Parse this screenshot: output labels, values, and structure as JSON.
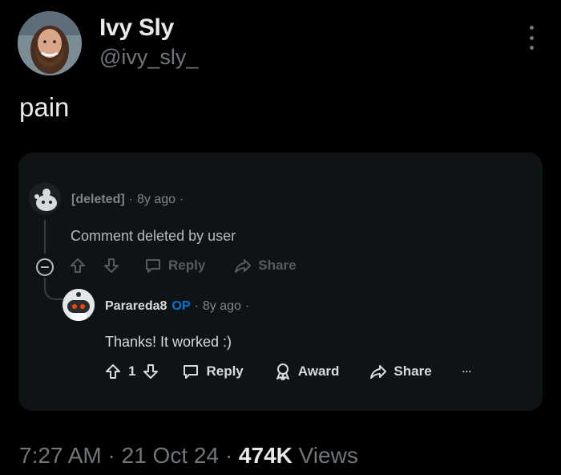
{
  "post": {
    "display_name": "Ivy Sly",
    "handle": "@ivy_sly_",
    "text": "pain",
    "time": "7:27 AM",
    "date": "21 Oct 24",
    "views_count": "474K",
    "views_label": "Views",
    "separator": "·"
  },
  "embed": {
    "parent_comment": {
      "author": "[deleted]",
      "age": "8y ago",
      "text": "Comment deleted by user",
      "actions": {
        "reply": "Reply",
        "share": "Share"
      }
    },
    "reply_comment": {
      "author": "Parareda8",
      "op_badge": "OP",
      "age": "8y ago",
      "text": "Thanks! It worked :)",
      "score": "1",
      "actions": {
        "reply": "Reply",
        "award": "Award",
        "share": "Share",
        "more": "···"
      }
    }
  },
  "colors": {
    "background": "#000000",
    "card": "#0e1416",
    "op_badge": "#0079d3",
    "muted": "#71767b"
  },
  "icons": [
    "more-vertical-icon",
    "upvote-icon",
    "downvote-icon",
    "reply-icon",
    "share-icon",
    "award-icon",
    "collapse-icon"
  ]
}
